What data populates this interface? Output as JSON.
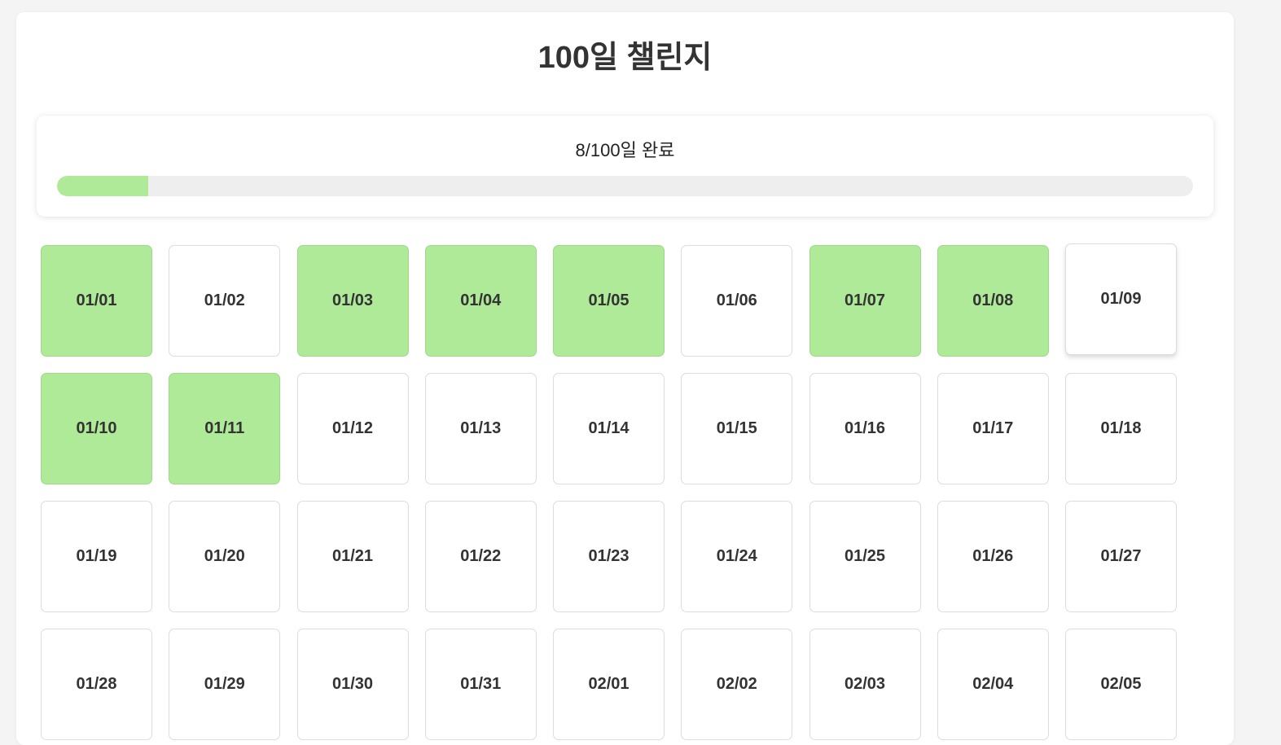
{
  "title": "100일 챌린지",
  "progress": {
    "text": "8/100일 완료",
    "completed": 8,
    "total": 100,
    "fill_color": "#aeea98",
    "track_color": "#eeeeee"
  },
  "days": [
    {
      "label": "01/01",
      "done": true
    },
    {
      "label": "01/02",
      "done": false
    },
    {
      "label": "01/03",
      "done": true
    },
    {
      "label": "01/04",
      "done": true
    },
    {
      "label": "01/05",
      "done": true
    },
    {
      "label": "01/06",
      "done": false
    },
    {
      "label": "01/07",
      "done": true
    },
    {
      "label": "01/08",
      "done": true
    },
    {
      "label": "01/09",
      "done": false,
      "hovered": true
    },
    {
      "label": "01/10",
      "done": true
    },
    {
      "label": "01/11",
      "done": true
    },
    {
      "label": "01/12",
      "done": false
    },
    {
      "label": "01/13",
      "done": false
    },
    {
      "label": "01/14",
      "done": false
    },
    {
      "label": "01/15",
      "done": false
    },
    {
      "label": "01/16",
      "done": false
    },
    {
      "label": "01/17",
      "done": false
    },
    {
      "label": "01/18",
      "done": false
    },
    {
      "label": "01/19",
      "done": false
    },
    {
      "label": "01/20",
      "done": false
    },
    {
      "label": "01/21",
      "done": false
    },
    {
      "label": "01/22",
      "done": false
    },
    {
      "label": "01/23",
      "done": false
    },
    {
      "label": "01/24",
      "done": false
    },
    {
      "label": "01/25",
      "done": false
    },
    {
      "label": "01/26",
      "done": false
    },
    {
      "label": "01/27",
      "done": false
    },
    {
      "label": "01/28",
      "done": false
    },
    {
      "label": "01/29",
      "done": false
    },
    {
      "label": "01/30",
      "done": false
    },
    {
      "label": "01/31",
      "done": false
    },
    {
      "label": "02/01",
      "done": false
    },
    {
      "label": "02/02",
      "done": false
    },
    {
      "label": "02/03",
      "done": false
    },
    {
      "label": "02/04",
      "done": false
    },
    {
      "label": "02/05",
      "done": false
    }
  ]
}
